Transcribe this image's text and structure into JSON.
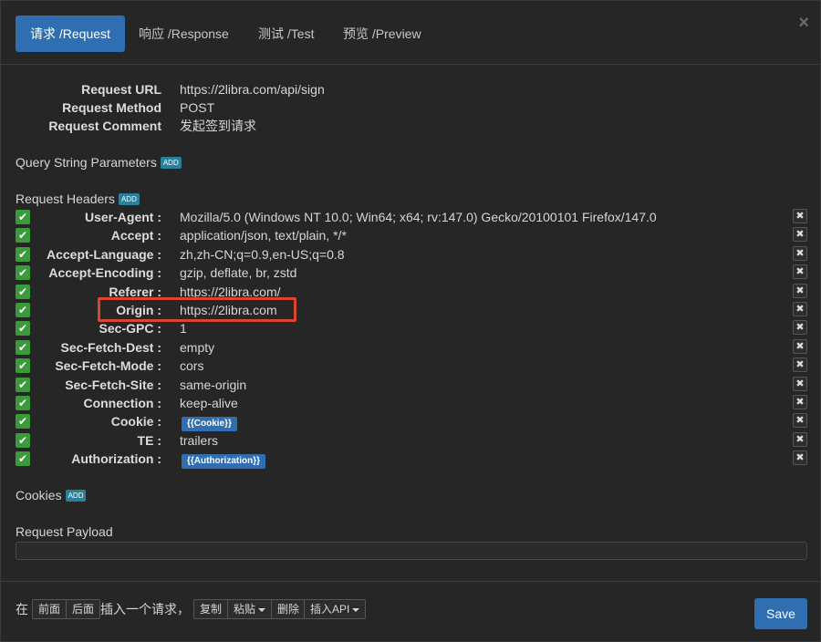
{
  "tabs": [
    {
      "label": "请求 /Request"
    },
    {
      "label": "响应 /Response"
    },
    {
      "label": "测试 /Test"
    },
    {
      "label": "预览 /Preview"
    }
  ],
  "close_glyph": "×",
  "info": {
    "url_label": "Request URL",
    "url_value": "https://2libra.com/api/sign",
    "method_label": "Request Method",
    "method_value": "POST",
    "comment_label": "Request Comment",
    "comment_value": "发起签到请求"
  },
  "sections": {
    "query": "Query String Parameters",
    "headers": "Request Headers",
    "cookies": "Cookies",
    "payload": "Request Payload",
    "add_label": "ADD"
  },
  "headers": [
    {
      "name": "User-Agent :",
      "value": "Mozilla/5.0 (Windows NT 10.0; Win64; x64; rv:147.0) Gecko/20100101 Firefox/147.0"
    },
    {
      "name": "Accept :",
      "value": "application/json, text/plain, */*"
    },
    {
      "name": "Accept-Language :",
      "value": "zh,zh-CN;q=0.9,en-US;q=0.8"
    },
    {
      "name": "Accept-Encoding :",
      "value": "gzip, deflate, br, zstd"
    },
    {
      "name": "Referer :",
      "value": "https://2libra.com/"
    },
    {
      "name": "Origin :",
      "value": "https://2libra.com"
    },
    {
      "name": "Sec-GPC :",
      "value": "1"
    },
    {
      "name": "Sec-Fetch-Dest :",
      "value": "empty"
    },
    {
      "name": "Sec-Fetch-Mode :",
      "value": "cors"
    },
    {
      "name": "Sec-Fetch-Site :",
      "value": "same-origin"
    },
    {
      "name": "Connection :",
      "value": "keep-alive"
    },
    {
      "name": "Cookie :",
      "tag": "{{Cookie}}"
    },
    {
      "name": "TE :",
      "value": "trailers"
    },
    {
      "name": "Authorization :",
      "tag": "{{Authorization}}"
    }
  ],
  "glyphs": {
    "check": "✔",
    "delete": "✖"
  },
  "footer": {
    "text_at": "在",
    "before": "前面",
    "after": "后面",
    "insert_text": "插入一个请求，",
    "copy": "复制",
    "paste": "粘贴",
    "delete": "删除",
    "insert_api": "插入API",
    "save": "Save"
  },
  "colors": {
    "accent": "#2f6fb1",
    "check": "#3b9b3b",
    "highlight": "#d9452f",
    "badge": "#2a7f9b"
  }
}
